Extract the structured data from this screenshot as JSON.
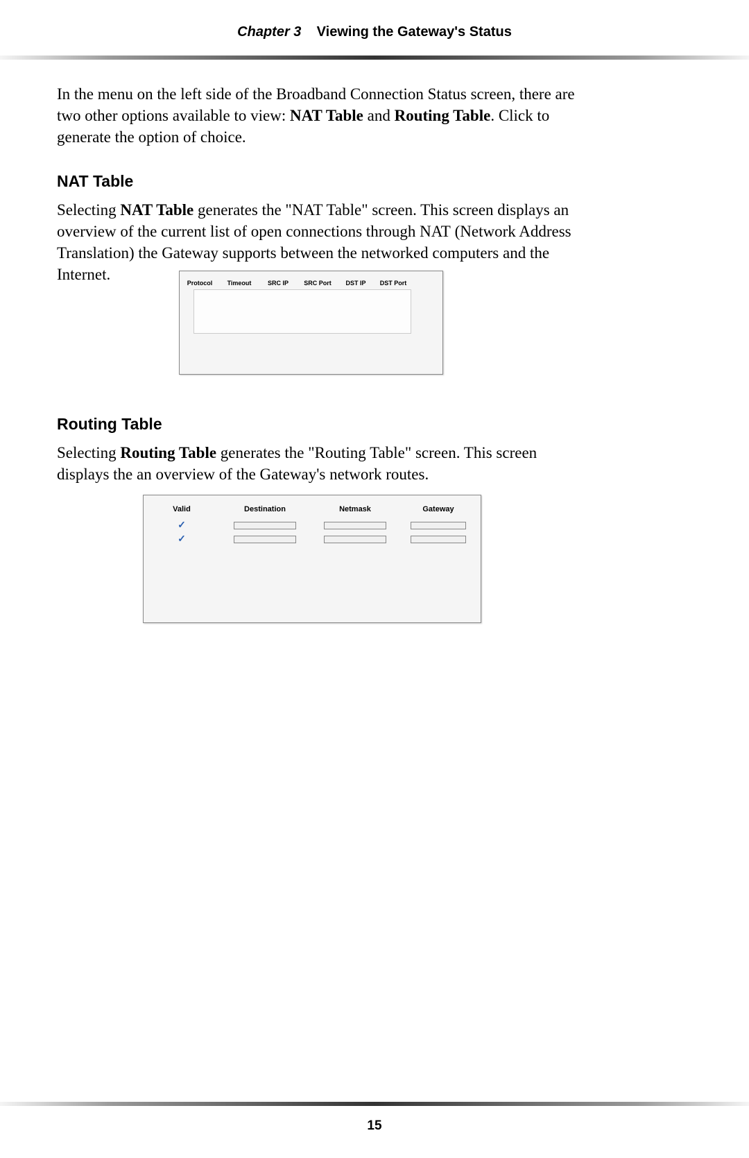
{
  "header": {
    "chapter_label": "Chapter 3",
    "chapter_title": "Viewing the Gateway's Status"
  },
  "intro": {
    "text_before": "In the menu on the left side of the Broadband Connection Status screen, there are two other options available to view: ",
    "bold1": "NAT Table",
    "mid": " and ",
    "bold2": "Routing Table",
    "text_after": ". Click to generate  the option of choice."
  },
  "nat_section": {
    "heading": "NAT Table",
    "para_before": "Selecting ",
    "para_bold": "NAT Table",
    "para_mid1": " generates the \"NAT Table\" screen. This screen displays an overview of the current list of open connections through ",
    "para_sc": "NAT",
    "para_after": " (Network Address Translation) the Gateway supports between the networked computers and the Internet.",
    "table": {
      "headers": [
        "Protocol",
        "Timeout",
        "SRC IP",
        "SRC Port",
        "DST IP",
        "DST Port"
      ]
    }
  },
  "routing_section": {
    "heading": "Routing Table",
    "para_before": "Selecting ",
    "para_bold": "Routing Table",
    "para_after": " generates the \"Routing Table\" screen. This screen displays the an overview of the Gateway's network routes.",
    "table": {
      "headers": [
        "Valid",
        "Destination",
        "Netmask",
        "Gateway"
      ],
      "rows": [
        {
          "valid": "✓",
          "destination": "",
          "netmask": "",
          "gateway": ""
        },
        {
          "valid": "✓",
          "destination": "",
          "netmask": "",
          "gateway": ""
        }
      ]
    }
  },
  "page_number": "15"
}
